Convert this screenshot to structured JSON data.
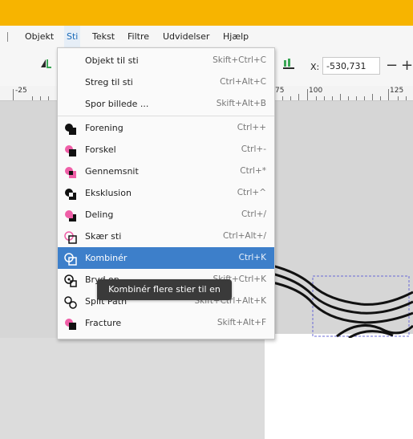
{
  "menubar": {
    "items": [
      {
        "label": "Objekt"
      },
      {
        "label": "Sti"
      },
      {
        "label": "Tekst"
      },
      {
        "label": "Filtre"
      },
      {
        "label": "Udvidelser"
      },
      {
        "label": "Hjælp"
      }
    ]
  },
  "toolbar": {
    "x_label": "X:",
    "x_value": "-530,731",
    "minus": "−",
    "plus": "+"
  },
  "ruler": {
    "labels": [
      "-25",
      "75",
      "100",
      "125"
    ]
  },
  "menu": {
    "items": [
      {
        "label": "Objekt til sti",
        "shortcut": "Skift+Ctrl+C"
      },
      {
        "label": "Streg til sti",
        "shortcut": "Ctrl+Alt+C"
      },
      {
        "label": "Spor billede ...",
        "shortcut": "Skift+Alt+B"
      },
      {
        "label": "Forening",
        "shortcut": "Ctrl++"
      },
      {
        "label": "Forskel",
        "shortcut": "Ctrl+-"
      },
      {
        "label": "Gennemsnit",
        "shortcut": "Ctrl+*"
      },
      {
        "label": "Eksklusion",
        "shortcut": "Ctrl+^"
      },
      {
        "label": "Deling",
        "shortcut": "Ctrl+/"
      },
      {
        "label": "Skær sti",
        "shortcut": "Ctrl+Alt+/"
      },
      {
        "label": "Kombinér",
        "shortcut": "Ctrl+K"
      },
      {
        "label": "Bryd op",
        "shortcut": "Skift+Ctrl+K"
      },
      {
        "label": "Split Path",
        "shortcut": "Skift+Ctrl+Alt+K"
      },
      {
        "label": "Fracture",
        "shortcut": "Skift+Alt+F"
      }
    ]
  },
  "tooltip": {
    "text": "Kombinér flere stier til en"
  },
  "colors": {
    "titlebar": "#f7b400",
    "highlight": "#3d7fca",
    "pink": "#ef5fa7"
  }
}
